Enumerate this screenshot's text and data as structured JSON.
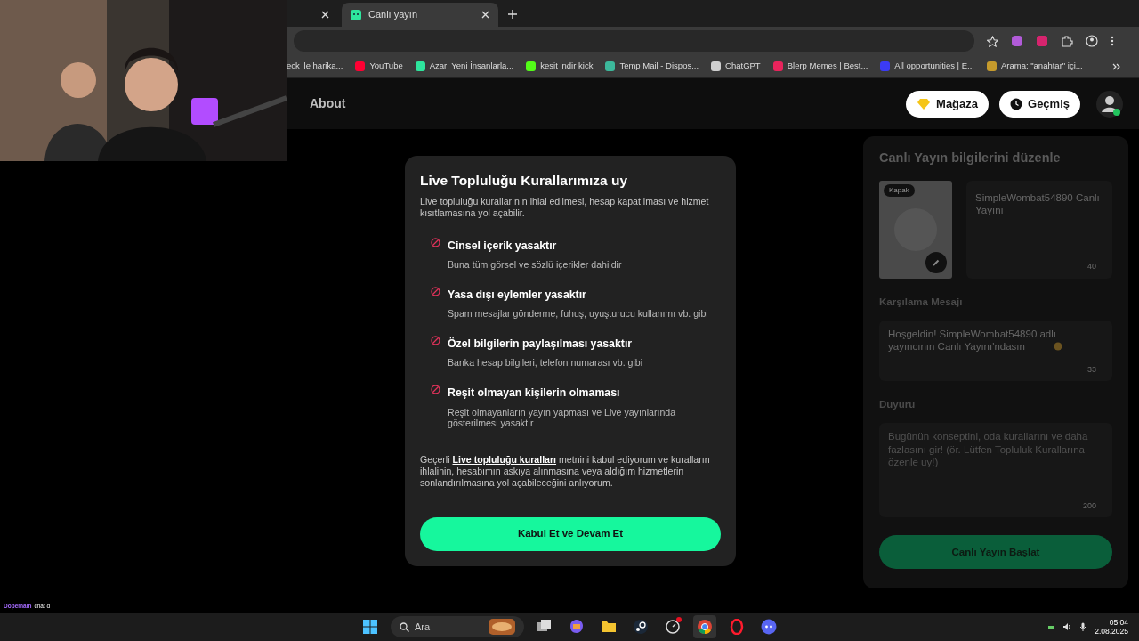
{
  "browser": {
    "tabs": [
      {
        "selected": false
      },
      {
        "label": "Canlı yayın",
        "selected": true
      }
    ],
    "bookmarks": [
      {
        "label": "eck ile harika..."
      },
      {
        "label": "YouTube",
        "color": "#ff0033"
      },
      {
        "label": "Azar: Yeni İnsanlarla...",
        "color": "#2ee59d"
      },
      {
        "label": "kesit indir kick",
        "color": "#53fc18"
      },
      {
        "label": "Temp Mail - Dispos...",
        "color": "#3cb89b"
      },
      {
        "label": "ChatGPT",
        "color": "#cfcfcf"
      },
      {
        "label": "Blerp Memes | Best...",
        "color": "#e8245c"
      },
      {
        "label": "All opportunities | E...",
        "color": "#3b3bf5"
      },
      {
        "label": "Arama: \"anahtar\" içi...",
        "color": "#c69b2c"
      }
    ]
  },
  "site_header": {
    "nav": [
      "About"
    ],
    "buttons": [
      {
        "kind": "store",
        "label": "Mağaza"
      },
      {
        "kind": "history",
        "label": "Geçmiş"
      }
    ]
  },
  "modal": {
    "title": "Live Topluluğu Kurallarımıza uy",
    "subtitle": "Live topluluğu kurallarının ihlal edilmesi, hesap kapatılması ve hizmet kısıtlamasına yol açabilir.",
    "rules": [
      {
        "title": "Cinsel içerik yasaktır",
        "description": "Buna tüm görsel ve sözlü içerikler dahildir"
      },
      {
        "title": "Yasa dışı eylemler yasaktır",
        "description": "Spam mesajlar gönderme, fuhuş, uyuşturucu kullanımı vb. gibi"
      },
      {
        "title": "Özel bilgilerin paylaşılması yasaktır",
        "description": "Banka hesap bilgileri, telefon numarası vb. gibi"
      },
      {
        "title": "Reşit olmayan kişilerin olmaması",
        "description": "Reşit olmayanların yayın yapması ve Live yayınlarında gösterilmesi yasaktır"
      }
    ],
    "consent": {
      "before": "Geçerli ",
      "link": "Live topluluğu kuralları",
      "after": " metnini kabul ediyorum ve kuralların ihlalinin, hesabımın askıya alınmasına veya aldığım hizmetlerin sonlandırılmasına yol açabileceğini anlıyorum."
    },
    "button": "Kabul Et ve Devam Et"
  },
  "stream_panel": {
    "title": "Canlı Yayın bilgilerini düzenle",
    "cover_badge": "Kapak",
    "title_field": {
      "value": "SimpleWombat54890 Canlı Yayını",
      "count": "40"
    },
    "welcome": {
      "label": "Karşılama Mesajı",
      "value": "Hoşgeldin! SimpleWombat54890 adlı yayıncının Canlı Yayını'ndasın",
      "count": "33"
    },
    "announcement": {
      "label": "Duyuru",
      "placeholder": "Bugünün konseptini, oda kurallarını ve daha fazlasını gir! (ör. Lütfen Topluluk Kurallarına özenle uy!)",
      "count": "200"
    },
    "button": "Canlı Yayın Başlat"
  },
  "chat_overlay": [
    {
      "user": "Dopemain",
      "text": "chat d"
    }
  ],
  "taskbar": {
    "search_placeholder": "Ara",
    "apps": [
      {
        "kind": "taskview",
        "selected": false,
        "notification": false
      },
      {
        "kind": "copilot",
        "selected": false,
        "notification": false
      },
      {
        "kind": "folder",
        "selected": false,
        "notification": false
      },
      {
        "kind": "steam",
        "selected": false,
        "notification": false
      },
      {
        "kind": "circle",
        "selected": false,
        "notification": true
      },
      {
        "kind": "chrome",
        "selected": true,
        "notification": false
      },
      {
        "kind": "opera",
        "selected": false,
        "notification": false
      },
      {
        "kind": "discord",
        "selected": false,
        "notification": false
      }
    ],
    "time": "05:04",
    "date": "2.08.2025"
  }
}
